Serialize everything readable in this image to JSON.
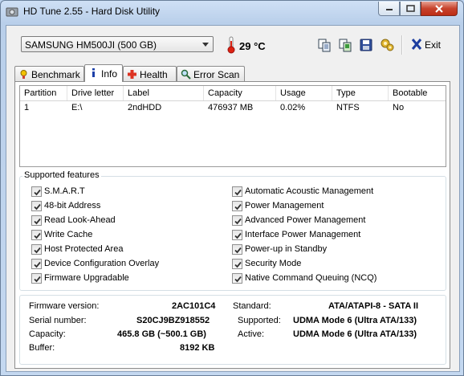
{
  "window": {
    "title": "HD Tune 2.55 - Hard Disk Utility"
  },
  "toolbar": {
    "drive": "SAMSUNG HM500JI (500 GB)",
    "temperature": "29 °C",
    "exit_label": "Exit",
    "buttons": [
      "copy-text-icon",
      "copy-screenshot-icon",
      "save-icon",
      "options-icon"
    ]
  },
  "tabs": [
    {
      "label": "Benchmark",
      "icon": "benchmark-icon",
      "active": false
    },
    {
      "label": "Info",
      "icon": "info-icon",
      "active": true
    },
    {
      "label": "Health",
      "icon": "health-icon",
      "active": false
    },
    {
      "label": "Error Scan",
      "icon": "error-scan-icon",
      "active": false
    }
  ],
  "partitions": {
    "columns": [
      "Partition",
      "Drive letter",
      "Label",
      "Capacity",
      "Usage",
      "Type",
      "Bootable"
    ],
    "rows": [
      [
        "1",
        "E:\\",
        "2ndHDD",
        "476937 MB",
        "0.02%",
        "NTFS",
        "No"
      ]
    ]
  },
  "features": {
    "title": "Supported features",
    "left": [
      {
        "label": "S.M.A.R.T",
        "checked": true
      },
      {
        "label": "48-bit Address",
        "checked": true
      },
      {
        "label": "Read Look-Ahead",
        "checked": true
      },
      {
        "label": "Write Cache",
        "checked": true
      },
      {
        "label": "Host Protected Area",
        "checked": true
      },
      {
        "label": "Device Configuration Overlay",
        "checked": true
      },
      {
        "label": "Firmware Upgradable",
        "checked": true
      }
    ],
    "right": [
      {
        "label": "Automatic Acoustic Management",
        "checked": true
      },
      {
        "label": "Power Management",
        "checked": true
      },
      {
        "label": "Advanced Power Management",
        "checked": true
      },
      {
        "label": "Interface Power Management",
        "checked": true
      },
      {
        "label": "Power-up in Standby",
        "checked": true
      },
      {
        "label": "Security Mode",
        "checked": true
      },
      {
        "label": "Native Command Queuing (NCQ)",
        "checked": true
      }
    ]
  },
  "info": {
    "firmware_label": "Firmware version:",
    "firmware": "2AC101C4",
    "serial_label": "Serial number:",
    "serial": "S20CJ9BZ918552",
    "capacity_label": "Capacity:",
    "capacity": "465.8 GB (~500.1 GB)",
    "buffer_label": "Buffer:",
    "buffer": "8192 KB",
    "standard_label": "Standard:",
    "standard": "ATA/ATAPI-8 - SATA II",
    "supported_label": "Supported:",
    "supported": "UDMA Mode 6 (Ultra ATA/133)",
    "active_label": "Active:",
    "active": "UDMA Mode 6 (Ultra ATA/133)"
  }
}
